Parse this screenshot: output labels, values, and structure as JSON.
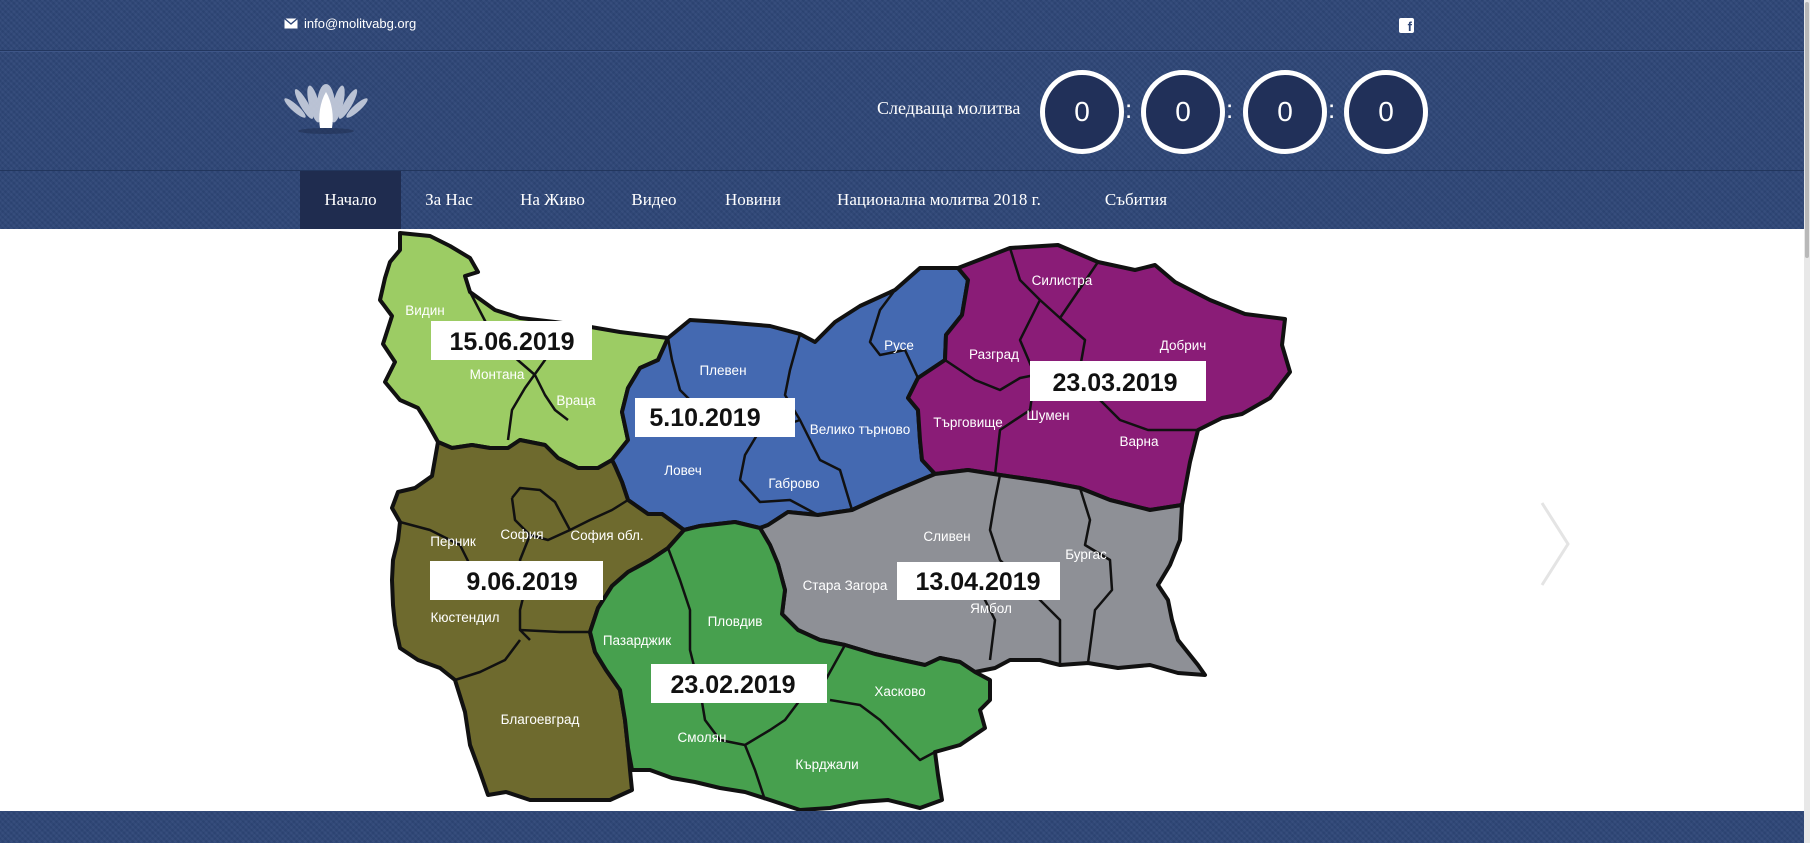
{
  "topbar": {
    "email": "info@molitvabg.org",
    "email_icon": "envelope-icon",
    "social_icon": "facebook-icon"
  },
  "header": {
    "logo_icon": "praying-hands-logo",
    "countdown_label": "Следваща молитва",
    "countdown": [
      "0",
      "0",
      "0",
      "0"
    ],
    "countdown_separator": ":"
  },
  "nav": {
    "items": [
      {
        "label": "Начало",
        "active": true
      },
      {
        "label": "За Нас",
        "active": false
      },
      {
        "label": "На Живо",
        "active": false
      },
      {
        "label": "Видео",
        "active": false
      },
      {
        "label": "Новини",
        "active": false
      },
      {
        "label": "Национална молитва 2018 г.",
        "active": false
      },
      {
        "label": "Събития",
        "active": false
      }
    ]
  },
  "slide": {
    "dates": {
      "northwest": "15.06.2019",
      "north": "5.10.2019",
      "northeast": "23.03.2019",
      "west": "9.06.2019",
      "east": "13.04.2019",
      "south": "23.02.2019"
    },
    "regions": {
      "vidin": "Видин",
      "montana": "Монтана",
      "vratsa": "Враца",
      "pleven": "Плевен",
      "ruse": "Русе",
      "silistra": "Силистра",
      "razgrad": "Разград",
      "dobrich": "Добрич",
      "shumen": "Шумен",
      "targovishte": "Търговище",
      "varna": "Варна",
      "veliko_tarnovo": "Велико търново",
      "lovech": "Ловеч",
      "gabrovo": "Габрово",
      "pernik": "Перник",
      "sofia": "София",
      "sofia_obl": "София обл.",
      "kyustendil": "Кюстендил",
      "blagoevgrad": "Благоевград",
      "pazardzhik": "Пазарджик",
      "plovdiv": "Пловдив",
      "smolyan": "Смолян",
      "kardzhali": "Кърджали",
      "haskovo": "Хасково",
      "stara_zagora": "Стара Загора",
      "sliven": "Сливен",
      "yambol": "Ямбол",
      "burgas": "Бургас"
    },
    "colors": {
      "northwest": "#9ccc64",
      "north": "#4469b1",
      "northeast": "#8a1c77",
      "west": "#6e6a2e",
      "east": "#8e9096",
      "south": "#47a04e"
    },
    "next_icon": "chevron-right-icon"
  }
}
